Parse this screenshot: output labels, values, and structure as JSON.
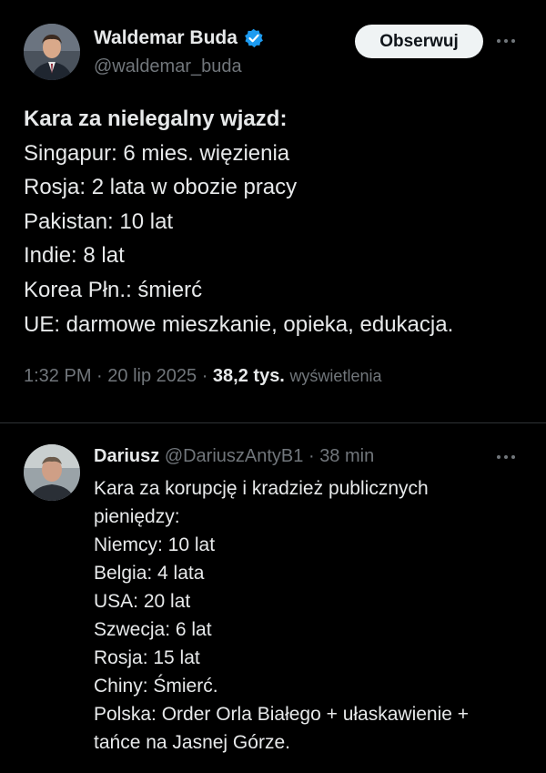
{
  "main_tweet": {
    "author_name": "Waldemar Buda",
    "handle": "@waldemar_buda",
    "follow_label": "Obserwuj",
    "lines": [
      "Kara za nielegalny wjazd:",
      "Singapur: 6 mies. więzienia",
      "Rosja: 2 lata w obozie pracy",
      "Pakistan: 10 lat",
      "Indie: 8 lat",
      "Korea Płn.: śmierć",
      "UE: darmowe mieszkanie, opieka, edukacja."
    ],
    "time": "1:32 PM",
    "date": "20 lip 2025",
    "views_count": "38,2 tys.",
    "views_label": "wyświetlenia"
  },
  "reply": {
    "author_name": "Dariusz",
    "handle": "@DariuszAntyB1",
    "time": "38 min",
    "lines": [
      "Kara za korupcję i kradzież publicznych",
      "pieniędzy:",
      "Niemcy: 10 lat",
      "Belgia: 4 lata",
      "USA: 20 lat",
      "Szwecja: 6 lat",
      "Rosja: 15 lat",
      "Chiny: Śmierć.",
      "Polska: Order Orla Białego + ułaskawienie +",
      "tańce na Jasnej Górze."
    ]
  },
  "icons": {
    "verified": "verified-badge-icon",
    "more": "more-options-icon"
  },
  "colors": {
    "background": "#000000",
    "text_primary": "#e7e9ea",
    "text_secondary": "#71767b",
    "verified_blue": "#1d9bf0",
    "divider": "#2f3336",
    "follow_button_bg": "#eff3f4"
  }
}
